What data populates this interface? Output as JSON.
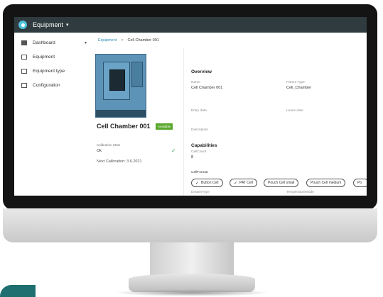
{
  "app": {
    "title": "Equipment",
    "caret": "▾"
  },
  "sidebar": {
    "items": [
      {
        "label": "Dashboard",
        "icon": "dashboard-icon",
        "chevron": "▾"
      },
      {
        "label": "Equipment",
        "icon": "equipment-icon"
      },
      {
        "label": "Equipment type",
        "icon": "equipment-type-icon"
      },
      {
        "label": "Configuration",
        "icon": "configuration-icon"
      }
    ]
  },
  "breadcrumb": {
    "root": "Equipment",
    "separator": ">",
    "current": "Cell Chamber 001"
  },
  "equipment": {
    "name": "Cell Chamber 001",
    "status": "Available",
    "calibration_state_label": "Calibration State",
    "calibration_state_value": "Ok",
    "next_calibration": "Next Calibration: 3.6.2021"
  },
  "overview": {
    "heading": "Overview",
    "name_label": "Name",
    "name_value": "Cell Chamber 001",
    "parent_type_label": "Parent Type",
    "parent_type_value": "Cell_Chamber",
    "entry_date_label": "Entry date",
    "leave_date_label": "Leave date",
    "description_label": "Description"
  },
  "capabilities": {
    "heading": "Capabilities",
    "cellcount_label": "CellCount",
    "cellcount_value": "8",
    "cellformat_label": "CellFormat",
    "formats": [
      {
        "label": "Button Cell",
        "checked": true
      },
      {
        "label": "PAT Cell",
        "checked": true
      },
      {
        "label": "Pouch Cell small",
        "checked": false
      },
      {
        "label": "Pouch Cell medium",
        "checked": false
      },
      {
        "label": "Po",
        "checked": false
      }
    ],
    "drawer_type_label": "DrawerType",
    "temperature_mode_label": "TemperatureMode"
  },
  "colors": {
    "topbar": "#2f3b3f",
    "accent": "#2c8fb8",
    "available": "#5aa82d",
    "check": "#4aa35c"
  }
}
